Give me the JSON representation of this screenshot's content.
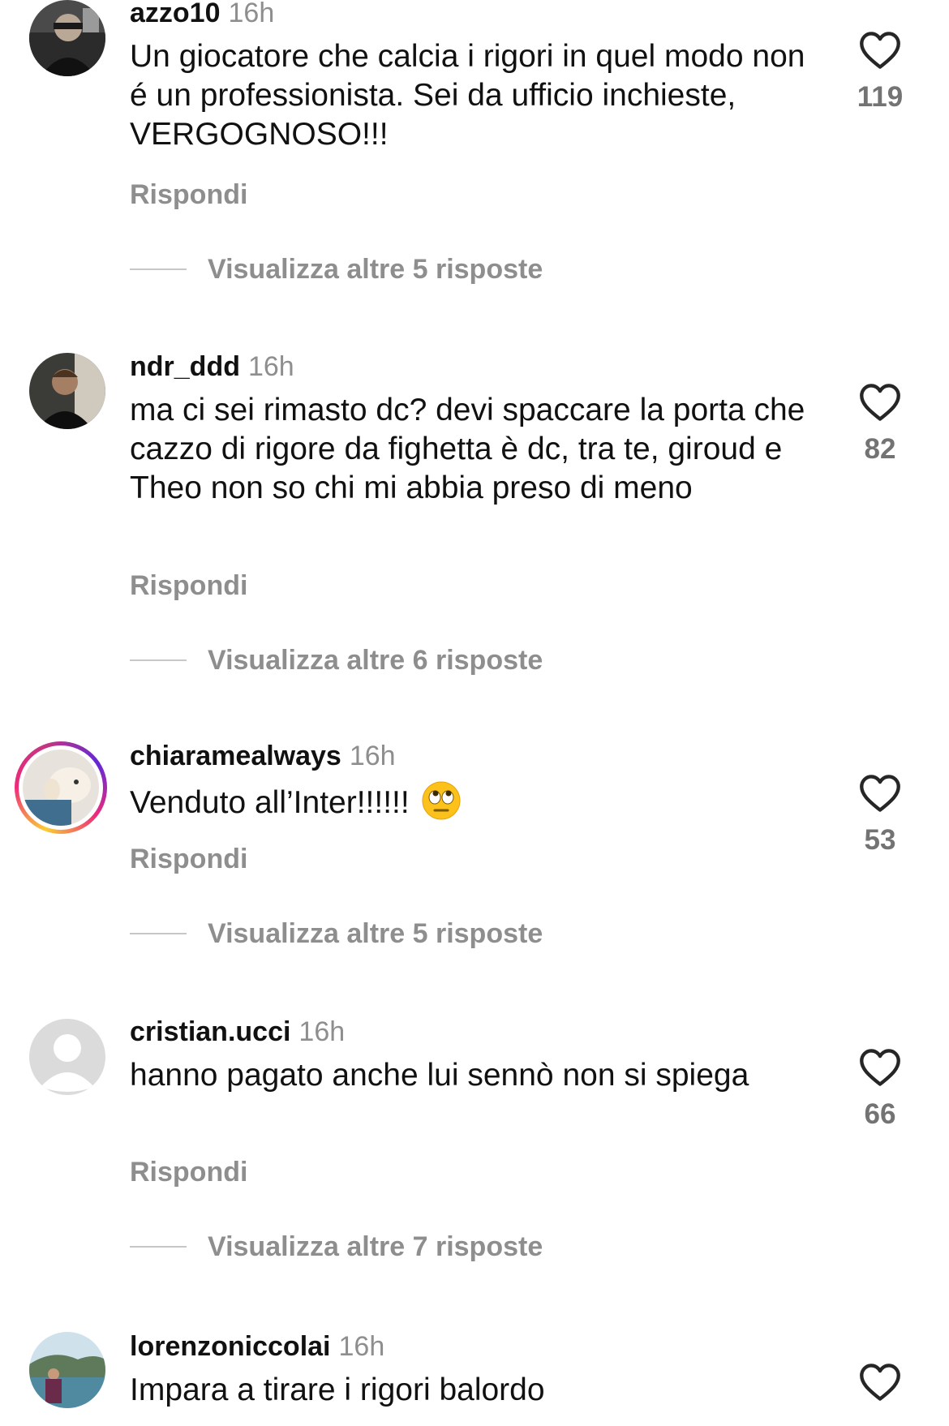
{
  "comments": [
    {
      "username": "azzo10",
      "time": "16h",
      "text": "Un giocatore che calcia i rigori in quel modo non é un professionista. Sei da ufficio inchieste, VERGOGNOSO!!!",
      "reply_label": "Rispondi",
      "likes": "119",
      "view_replies": "Visualizza altre 5 risposte"
    },
    {
      "username": "ndr_ddd",
      "time": "16h",
      "text": "ma ci sei rimasto dc? devi spaccare la porta che cazzo di rigore da fighetta è dc, tra te, giroud e Theo non so chi mi abbia preso di meno",
      "reply_label": "Rispondi",
      "likes": "82",
      "view_replies": "Visualizza altre 6 risposte"
    },
    {
      "username": "chiaramealways",
      "time": "16h",
      "text": "Venduto all’Inter!!!!!!",
      "emoji": "face-with-rolling-eyes",
      "reply_label": "Rispondi",
      "likes": "53",
      "view_replies": "Visualizza altre 5 risposte"
    },
    {
      "username": "cristian.ucci",
      "time": "16h",
      "text": "hanno pagato anche lui sennò non si spiega",
      "reply_label": "Rispondi",
      "likes": "66",
      "view_replies": "Visualizza altre 7 risposte"
    },
    {
      "username": "lorenzoniccolai",
      "time": "16h",
      "text": "Impara a tirare i rigori balordo"
    }
  ],
  "icons": {
    "like": "heart-outline-icon",
    "default_avatar": "default-avatar-icon"
  },
  "colors": {
    "muted_text": "#8e8e8e",
    "story_ring": [
      "#f9ce34",
      "#ee2a7b",
      "#6228d7"
    ]
  }
}
